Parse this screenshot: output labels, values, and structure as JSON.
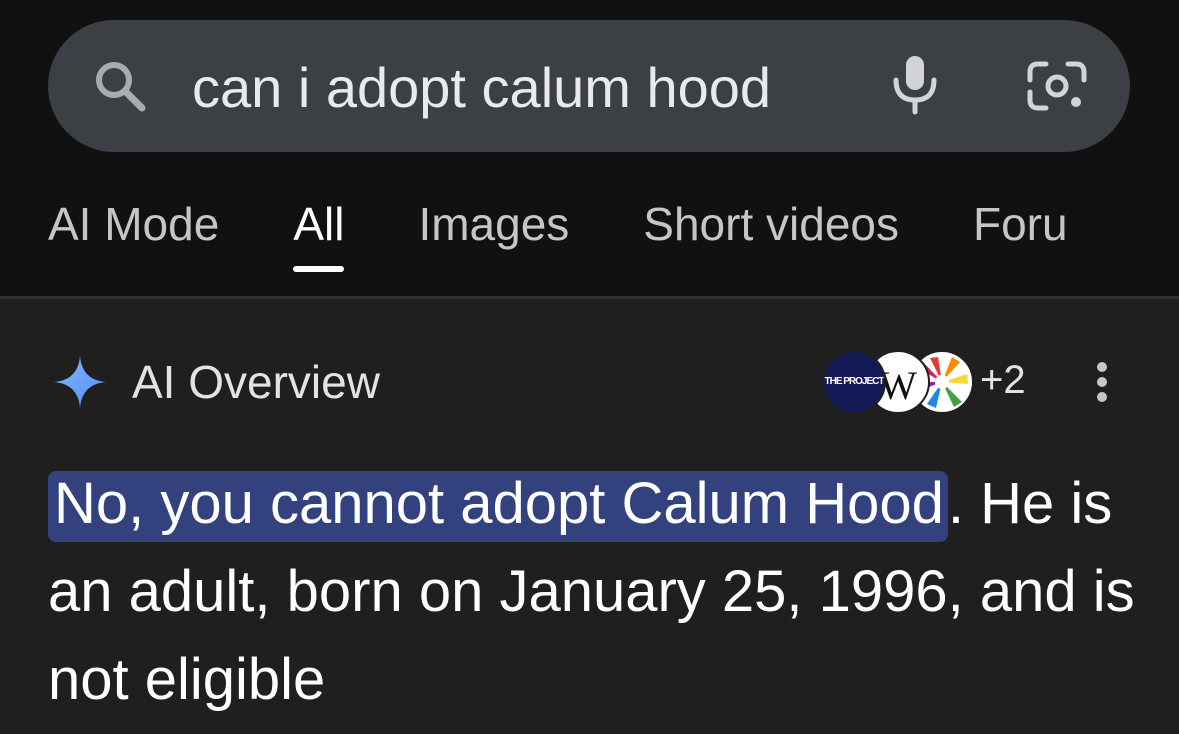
{
  "search": {
    "query": "can i adopt calum hood",
    "icons": [
      "search-icon",
      "mic-icon",
      "lens-icon"
    ]
  },
  "tabs": [
    {
      "label": "AI Mode",
      "active": false
    },
    {
      "label": "All",
      "active": true
    },
    {
      "label": "Images",
      "active": false
    },
    {
      "label": "Short videos",
      "active": false
    },
    {
      "label": "Foru",
      "active": false
    }
  ],
  "ai_overview": {
    "title": "AI Overview",
    "sources": {
      "project_logo_text": "THE PROJECT",
      "wiki_logo_text": "W",
      "more_count": "+2"
    },
    "answer_highlight": "No, you cannot adopt Calum Hood",
    "answer_rest": ". He is an adult, born on January 25, 1996, and is not eligible"
  },
  "colors": {
    "top_bg": "#111111",
    "page_bg": "#1f1f1f",
    "search_bg": "#3c3f43",
    "highlight": "#33427f",
    "sparkle": "#4f8ff7"
  }
}
